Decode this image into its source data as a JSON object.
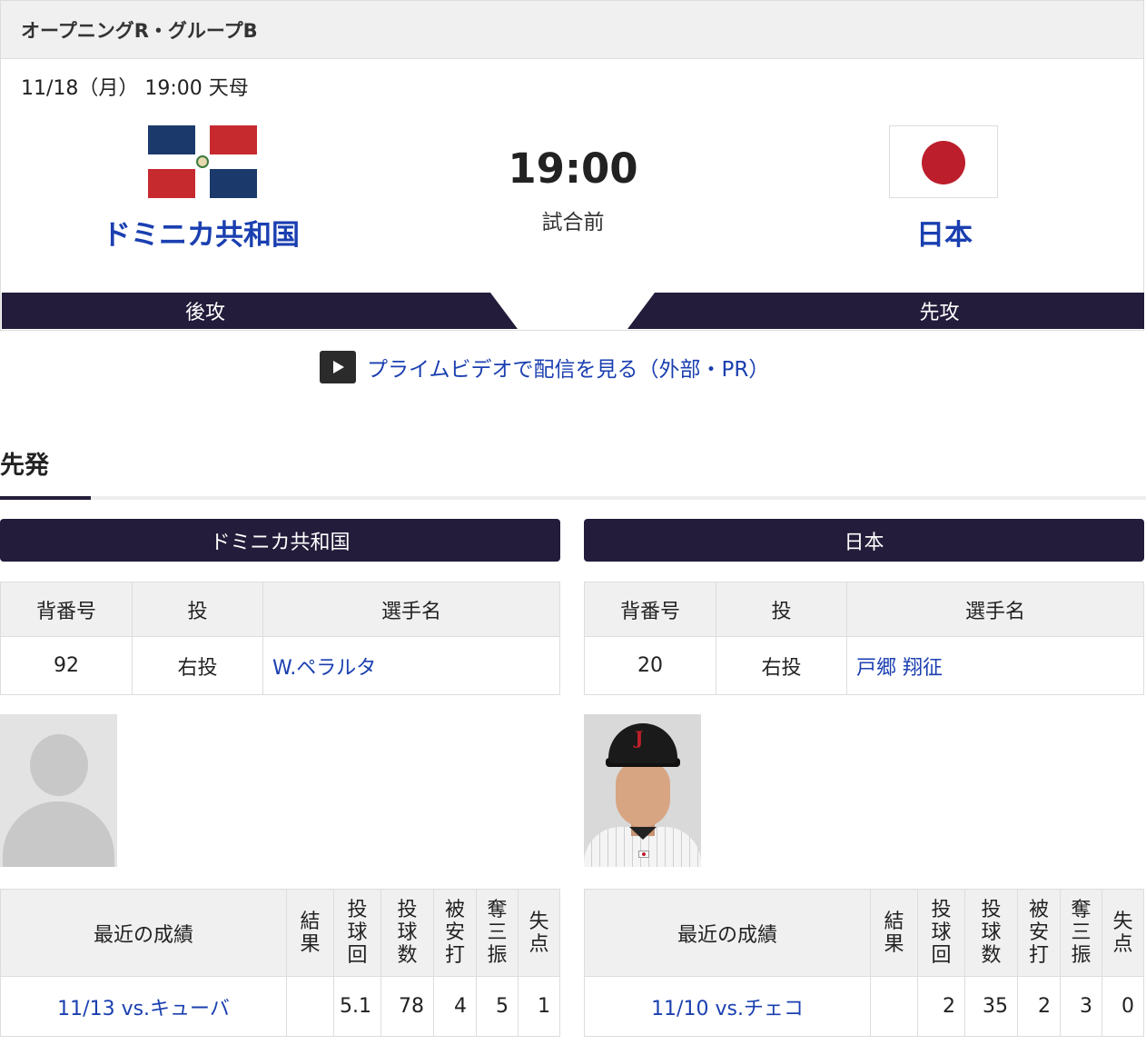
{
  "match": {
    "group": "オープニングR・グループB",
    "date_venue": "11/18（月） 19:00 天母",
    "score": "19:00",
    "status": "試合前",
    "home": {
      "name": "ドミニカ共和国",
      "order": "後攻"
    },
    "away": {
      "name": "日本",
      "order": "先攻"
    }
  },
  "prime": {
    "label": "プライムビデオで配信を見る（外部・PR）",
    "icon": "play-icon"
  },
  "section": {
    "title": "先発"
  },
  "starter_headers": [
    "背番号",
    "投",
    "選手名"
  ],
  "stats_headers": {
    "recent": "最近の成績",
    "cols": [
      [
        "結",
        "果"
      ],
      [
        "投",
        "球",
        "回"
      ],
      [
        "投",
        "球",
        "数"
      ],
      [
        "被",
        "安",
        "打"
      ],
      [
        "奪",
        "三",
        "振"
      ],
      [
        "失",
        "点"
      ]
    ]
  },
  "teams": [
    {
      "name": "ドミニカ共和国",
      "pitcher": {
        "number": "92",
        "throws": "右投",
        "name": "W.ペラルタ"
      },
      "recent": {
        "game": "11/13 vs.キューバ",
        "result": "",
        "innings": "5.1",
        "pitches": "78",
        "hits": "4",
        "strikeouts": "5",
        "runs": "1"
      }
    },
    {
      "name": "日本",
      "pitcher": {
        "number": "20",
        "throws": "右投",
        "name": "戸郷 翔征"
      },
      "recent": {
        "game": "11/10 vs.チェコ",
        "result": "",
        "innings": "2",
        "pitches": "35",
        "hits": "2",
        "strikeouts": "3",
        "runs": "0"
      }
    }
  ],
  "colors": {
    "accent": "#231c3a",
    "link": "#1a3fb0",
    "header_bg": "#f0f0f0"
  }
}
